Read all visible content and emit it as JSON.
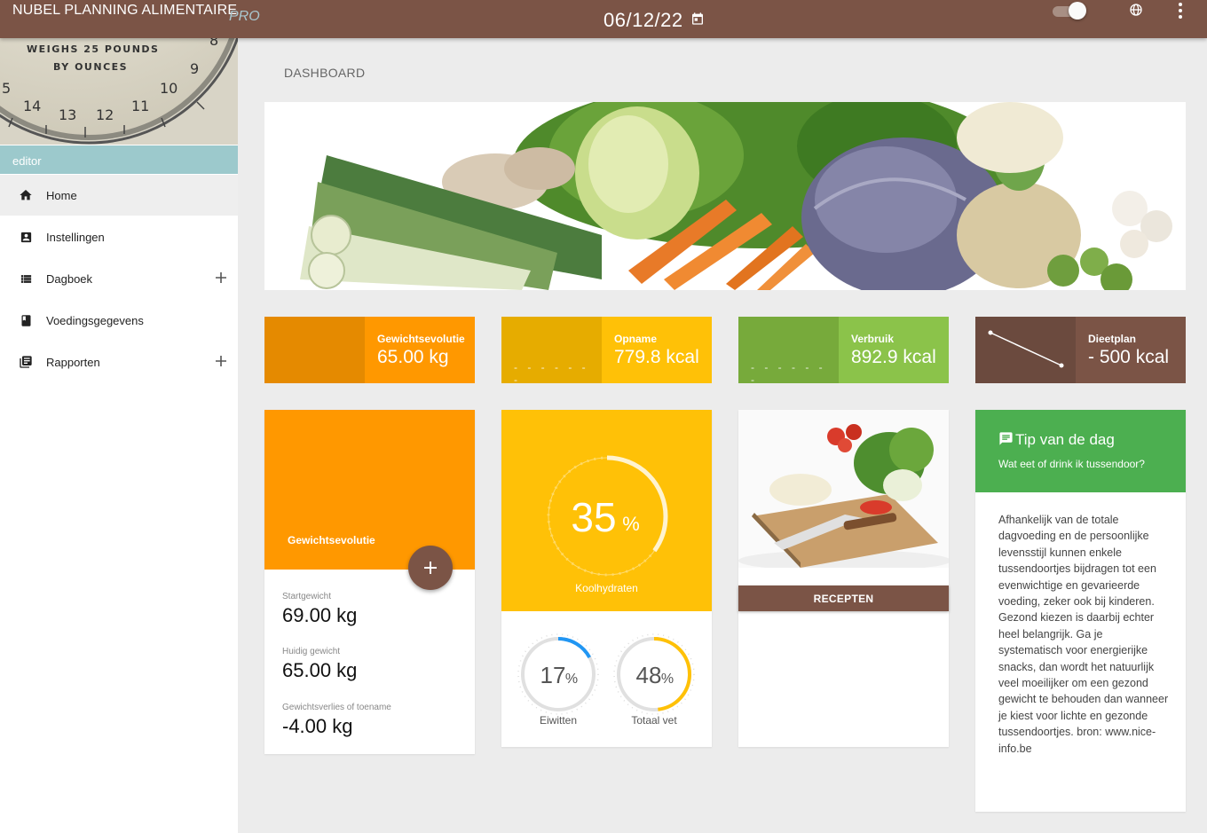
{
  "header": {
    "app_title": "NUBEL PLANNING ALIMENTAIRE",
    "app_edition": "PRO",
    "date": "06/12/22",
    "icons": [
      "calendar-icon",
      "toggle-switch",
      "globe-icon",
      "more-vert-icon"
    ]
  },
  "sidebar": {
    "scale_numbers": [
      "8",
      "9",
      "10",
      "11",
      "12",
      "13",
      "14",
      "5"
    ],
    "scale_text_line1": "WEIGHS 25 POUNDS",
    "scale_text_line2": "BY OUNCES",
    "role": "editor",
    "items": [
      {
        "label": "Home",
        "icon": "home-icon",
        "active": true
      },
      {
        "label": "Instellingen",
        "icon": "account-box-icon"
      },
      {
        "label": "Dagboek",
        "icon": "list-icon",
        "expandable": true
      },
      {
        "label": "Voedingsgegevens",
        "icon": "book-icon"
      },
      {
        "label": "Rapporten",
        "icon": "library-books-icon",
        "expandable": true
      }
    ]
  },
  "main": {
    "page_title": "DASHBOARD",
    "stats": [
      {
        "label": "Gewichtsevolutie",
        "value": "65.00 kg",
        "color_dark": "#e58a00",
        "color_light": "#ff9800"
      },
      {
        "label": "Opname",
        "value": "779.8 kcal",
        "color_dark": "#e6ac00",
        "color_light": "#ffc107",
        "dashes": "- - - - - - -"
      },
      {
        "label": "Verbruik",
        "value": "892.9 kcal",
        "color_dark": "#77aa3b",
        "color_light": "#8bc34a",
        "dashes": "- - - - - - -"
      },
      {
        "label": "Dieetplan",
        "value": "- 500 kcal",
        "color_dark": "#6b4a3e",
        "color_light": "#7b5446"
      }
    ],
    "weight_card": {
      "title": "Gewichtsevolutie",
      "start_label": "Startgewicht",
      "start_value": "69.00 kg",
      "current_label": "Huidig gewicht",
      "current_value": "65.00 kg",
      "change_label": "Gewichtsverlies of toename",
      "change_value": "-4.00 kg"
    },
    "macros_card": {
      "carbs": {
        "value": "35",
        "unit": "%",
        "label": "Koolhydraten",
        "fraction": 0.35
      },
      "protein": {
        "value": "17",
        "unit": "%",
        "label": "Eiwitten",
        "fraction": 0.17,
        "color": "#2196f3"
      },
      "fat": {
        "value": "48",
        "unit": "%",
        "label": "Totaal vet",
        "fraction": 0.48,
        "color": "#ffc107"
      }
    },
    "recipes_card": {
      "button": "RECEPTEN"
    },
    "tip_card": {
      "title": "Tip van de dag",
      "question": "Wat eet of drink ik tussendoor?",
      "body": "Afhankelijk van de totale dagvoeding en de persoonlijke levensstijl kunnen enkele tussendoortjes bijdragen tot een evenwichtige en gevarieerde voeding, zeker ook bij kinderen. Gezond kiezen is daarbij echter heel belangrijk. Ga je systematisch voor energierijke snacks, dan wordt het natuurlijk veel moeilijker om een gezond gewicht te behouden dan wanneer je kiest voor lichte en gezonde tussendoortjes. bron: www.nice-info.be"
    }
  }
}
